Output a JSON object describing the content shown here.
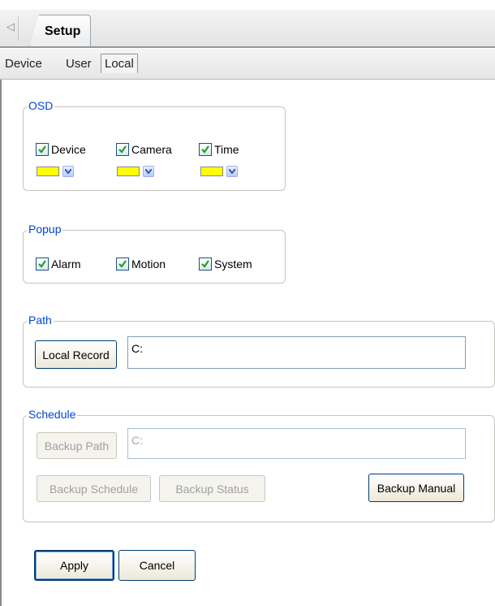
{
  "header": {
    "collapse_glyph": "◁",
    "tab_title": "Setup"
  },
  "subtabs": [
    {
      "label": "Device"
    },
    {
      "label": "User"
    },
    {
      "label": "Local",
      "active": true
    }
  ],
  "osd": {
    "title": "OSD",
    "items": [
      {
        "label": "Device",
        "checked": true,
        "color": "#ffff00"
      },
      {
        "label": "Camera",
        "checked": true,
        "color": "#ffff00"
      },
      {
        "label": "Time",
        "checked": true,
        "color": "#ffff00"
      }
    ]
  },
  "popup": {
    "title": "Popup",
    "items": [
      {
        "label": "Alarm",
        "checked": true
      },
      {
        "label": "Motion",
        "checked": true
      },
      {
        "label": "System",
        "checked": true
      }
    ]
  },
  "path": {
    "title": "Path",
    "button_label": "Local Record",
    "value": "C:"
  },
  "schedule": {
    "title": "Schedule",
    "backup_path_label": "Backup Path",
    "backup_path_value": "C:",
    "backup_schedule_label": "Backup Schedule",
    "backup_status_label": "Backup Status",
    "backup_manual_label": "Backup Manual"
  },
  "footer": {
    "apply_label": "Apply",
    "cancel_label": "Cancel"
  },
  "colors": {
    "accent_title": "#0046d5",
    "check": "#21a121",
    "border": "#003c74"
  }
}
